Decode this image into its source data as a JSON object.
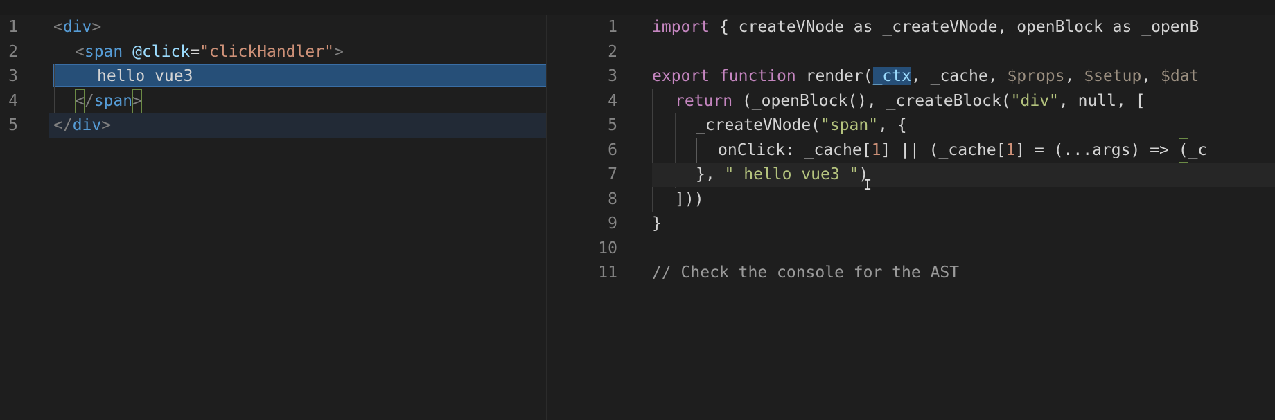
{
  "left_editor": {
    "line_numbers": [
      "1",
      "2",
      "3",
      "4",
      "5"
    ],
    "lines": {
      "l1": {
        "open": "<",
        "tag": "div",
        "close": ">"
      },
      "l2": {
        "open": "<",
        "tag": "span",
        "space": " ",
        "attr": "@click",
        "eq": "=",
        "value": "\"clickHandler\"",
        "close": ">"
      },
      "l3": {
        "text": "hello vue3"
      },
      "l4": {
        "open": "<",
        "slash": "/",
        "tag": "span",
        "close": ">"
      },
      "l5": {
        "open": "</",
        "tag": "div",
        "close": ">"
      }
    }
  },
  "right_editor": {
    "line_numbers": [
      "1",
      "2",
      "3",
      "4",
      "5",
      "6",
      "7",
      "8",
      "9",
      "10",
      "11"
    ],
    "lines": {
      "l1": {
        "kw": "import",
        "rest": " { createVNode as _createVNode, openBlock as _openB"
      },
      "l3": {
        "kw1": "export",
        "kw2": "function",
        "fn": "render(",
        "ctx": "_ctx",
        "mid": ", _cache, ",
        "p1": "$props",
        "c1": ", ",
        "p2": "$setup",
        "c2": ", ",
        "p3": "$dat"
      },
      "l4": {
        "kw": "return",
        "pre": " (_openBlock(), _createBlock(",
        "str": "\"div\"",
        "post": ", null, ["
      },
      "l5": {
        "pre": "_createVNode(",
        "str": "\"span\"",
        "post": ", {"
      },
      "l6": {
        "a": "onClick: _cache[",
        "n1": "1",
        "b": "] || (_cache[",
        "n2": "1",
        "c": "] = (...args) => ",
        "d": "(",
        "e": "_c"
      },
      "l7": {
        "pre": "}, ",
        "str": "\" hello vue3 \"",
        "post": ")"
      },
      "l8": {
        "text": "]))"
      },
      "l9": {
        "text": "}"
      },
      "l11": {
        "comment": "// Check the console for the AST"
      }
    }
  },
  "colors": {
    "background": "#1e1e1e",
    "selection": "#264f78",
    "tag": "#569cd6",
    "attribute": "#9cdcfe",
    "string": "#ce9178",
    "keyword": "#c586c0",
    "comment": "#9a9a9a"
  },
  "icons": {
    "cursor": "text-cursor-icon"
  }
}
